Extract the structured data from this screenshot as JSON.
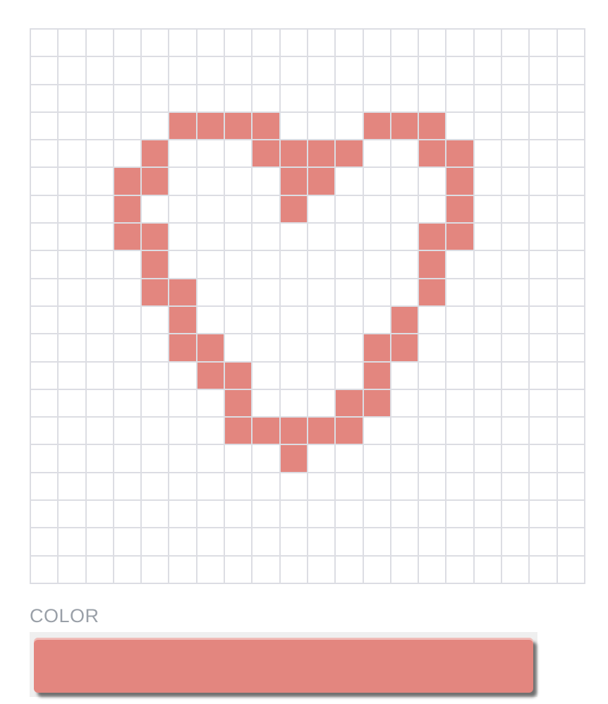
{
  "palette": {
    "label": "COLOR",
    "selected_color": "#e3867f",
    "empty_cell_color": "#ffffff",
    "grid_line_color": "#dcdde3"
  },
  "canvas": {
    "columns": 20,
    "rows": 20,
    "filled_cells": [
      [
        3,
        5
      ],
      [
        3,
        6
      ],
      [
        3,
        7
      ],
      [
        3,
        8
      ],
      [
        3,
        12
      ],
      [
        3,
        13
      ],
      [
        3,
        14
      ],
      [
        4,
        4
      ],
      [
        4,
        8
      ],
      [
        4,
        9
      ],
      [
        4,
        10
      ],
      [
        4,
        11
      ],
      [
        4,
        14
      ],
      [
        4,
        15
      ],
      [
        5,
        3
      ],
      [
        5,
        4
      ],
      [
        5,
        9
      ],
      [
        5,
        10
      ],
      [
        5,
        15
      ],
      [
        6,
        3
      ],
      [
        6,
        9
      ],
      [
        6,
        15
      ],
      [
        7,
        3
      ],
      [
        7,
        4
      ],
      [
        7,
        14
      ],
      [
        7,
        15
      ],
      [
        8,
        4
      ],
      [
        8,
        14
      ],
      [
        9,
        4
      ],
      [
        9,
        5
      ],
      [
        9,
        14
      ],
      [
        10,
        5
      ],
      [
        10,
        13
      ],
      [
        11,
        5
      ],
      [
        11,
        6
      ],
      [
        11,
        12
      ],
      [
        11,
        13
      ],
      [
        12,
        6
      ],
      [
        12,
        7
      ],
      [
        12,
        12
      ],
      [
        13,
        7
      ],
      [
        13,
        11
      ],
      [
        13,
        12
      ],
      [
        14,
        7
      ],
      [
        14,
        8
      ],
      [
        14,
        9
      ],
      [
        14,
        10
      ],
      [
        14,
        11
      ],
      [
        15,
        9
      ]
    ]
  }
}
